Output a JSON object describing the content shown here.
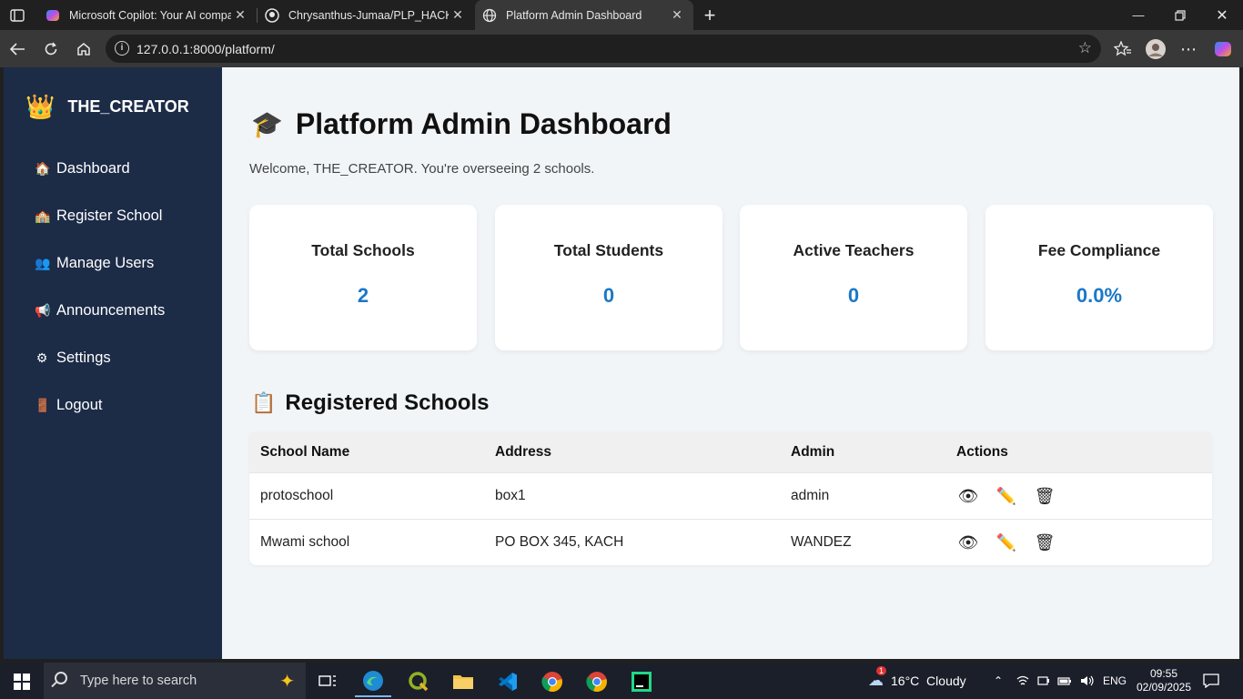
{
  "browser": {
    "tabs": [
      {
        "label": "Microsoft Copilot: Your AI compan",
        "icon": "copilot-icon"
      },
      {
        "label": "Chrysanthus-Jumaa/PLP_HACKATH",
        "icon": "github-icon"
      },
      {
        "label": "Platform Admin Dashboard",
        "icon": "globe-icon",
        "active": true
      }
    ],
    "url": "127.0.0.1:8000/platform/"
  },
  "sidebar": {
    "brand": "THE_CREATOR",
    "items": [
      {
        "label": "Dashboard",
        "icon": "🏠"
      },
      {
        "label": "Register School",
        "icon": "🏫"
      },
      {
        "label": "Manage Users",
        "icon": "👥"
      },
      {
        "label": "Announcements",
        "icon": "📢"
      },
      {
        "label": "Settings",
        "icon": "⚙"
      },
      {
        "label": "Logout",
        "icon": "🚪"
      }
    ]
  },
  "main": {
    "title": "Platform Admin Dashboard",
    "welcome": "Welcome, THE_CREATOR. You're overseeing 2 schools.",
    "stats": [
      {
        "label": "Total Schools",
        "value": "2"
      },
      {
        "label": "Total Students",
        "value": "0"
      },
      {
        "label": "Active Teachers",
        "value": "0"
      },
      {
        "label": "Fee Compliance",
        "value": "0.0%"
      }
    ],
    "schools_heading": "Registered Schools",
    "table": {
      "headers": [
        "School Name",
        "Address",
        "Admin",
        "Actions"
      ],
      "rows": [
        {
          "name": "protoschool",
          "address": "box1",
          "admin": "admin"
        },
        {
          "name": "Mwami school",
          "address": "PO BOX 345, KACH",
          "admin": "WANDEZ"
        }
      ]
    }
  },
  "taskbar": {
    "search_placeholder": "Type here to search",
    "weather": "16°C  Cloudy",
    "weather_badge": "1",
    "language": "ENG",
    "time": "09:55",
    "date": "02/09/2025"
  },
  "colors": {
    "sidebar_bg": "#1c2b46",
    "page_bg": "#f2f5f8",
    "stat_value": "#1b78c6"
  }
}
